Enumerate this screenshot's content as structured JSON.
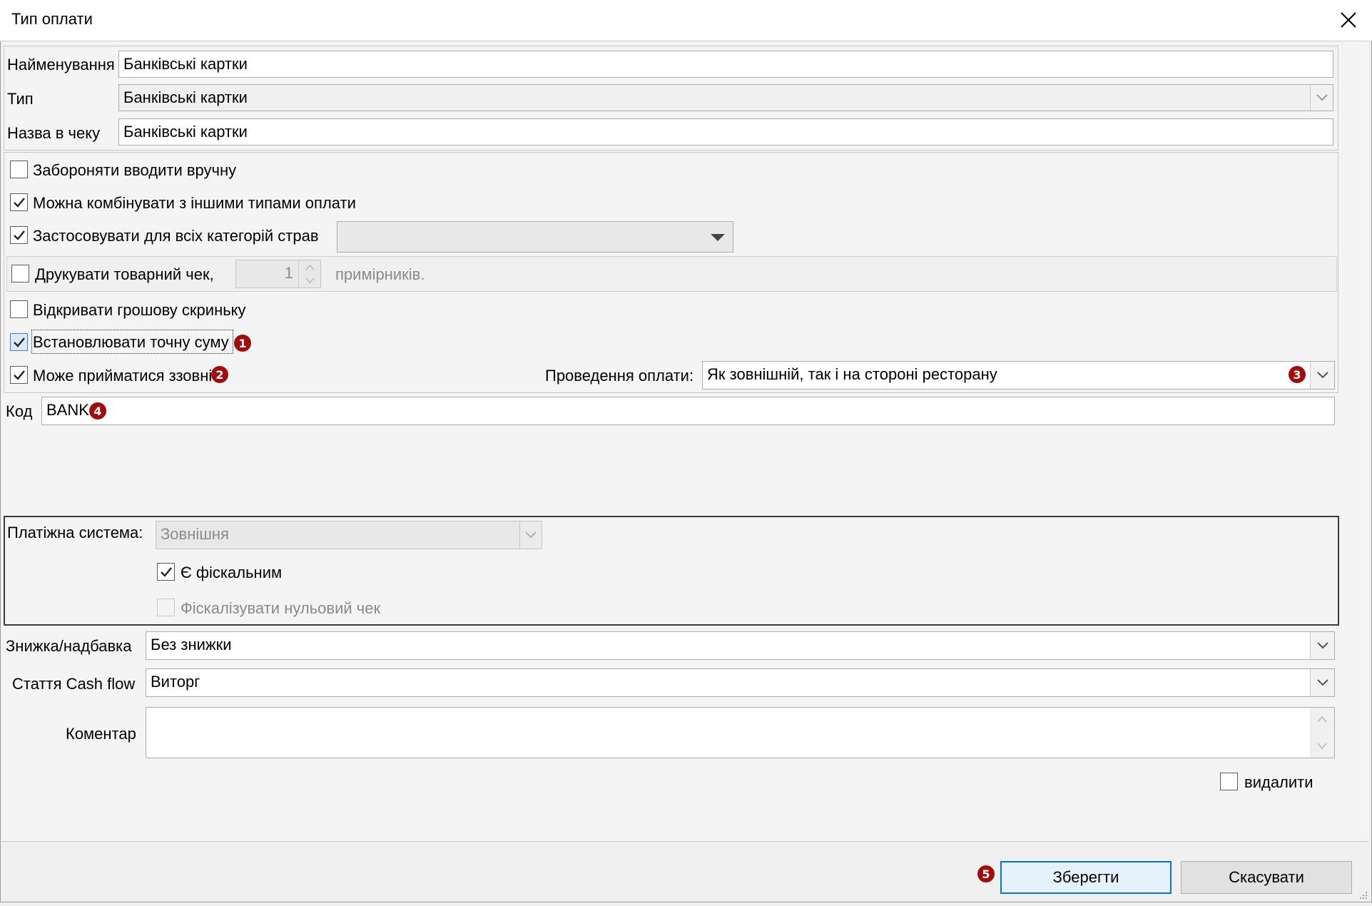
{
  "window": {
    "title": "Тип оплати"
  },
  "main": {
    "name_label": "Найменування",
    "name_value": "Банківські картки",
    "type_label": "Тип",
    "type_value": "Банківські картки",
    "receipt_label": "Назва в чеку",
    "receipt_value": "Банківські картки"
  },
  "options": {
    "forbid_manual": {
      "label": "Забороняти вводити вручну",
      "checked": false
    },
    "combine": {
      "label": "Можна комбінувати з іншими типами оплати",
      "checked": true
    },
    "all_categories": {
      "label": "Застосовувати для всіх категорій страв",
      "checked": true,
      "select_value": ""
    },
    "print_receipt": {
      "label": "Друкувати товарний чек,",
      "checked": false,
      "copies": "1",
      "suffix": "примірників."
    },
    "open_drawer": {
      "label": "Відкривати грошову скриньку",
      "checked": false
    },
    "exact_sum": {
      "label": "Встановлювати точну суму",
      "checked": true
    },
    "external": {
      "label": "Може прийматися ззовні",
      "checked": true
    },
    "processing_label": "Проведення оплати:",
    "processing_value": "Як зовнішній, так і на стороні ресторану"
  },
  "code": {
    "label": "Код",
    "value": "BANK"
  },
  "payment_system": {
    "label": "Платіжна система:",
    "value": "Зовнішня",
    "fiscal": {
      "label": "Є фіскальним",
      "checked": true
    },
    "fiscalize_zero": {
      "label": "Фіскалізувати нульовий чек",
      "checked": false
    }
  },
  "bottom": {
    "discount_label": "Знижка/надбавка",
    "discount_value": "Без знижки",
    "cashflow_label": "Стаття Cash flow",
    "cashflow_value": "Виторг",
    "comment_label": "Коментар",
    "comment_value": "",
    "delete_label": "видалити"
  },
  "buttons": {
    "save": "Зберегти",
    "cancel": "Скасувати"
  },
  "badges": {
    "b1": "1",
    "b2": "2",
    "b3": "3",
    "b4": "4",
    "b5": "5"
  },
  "colors": {
    "badge": "#a10d0d",
    "primary_border": "#0a74d4",
    "window_bg": "#f4f4f4"
  }
}
